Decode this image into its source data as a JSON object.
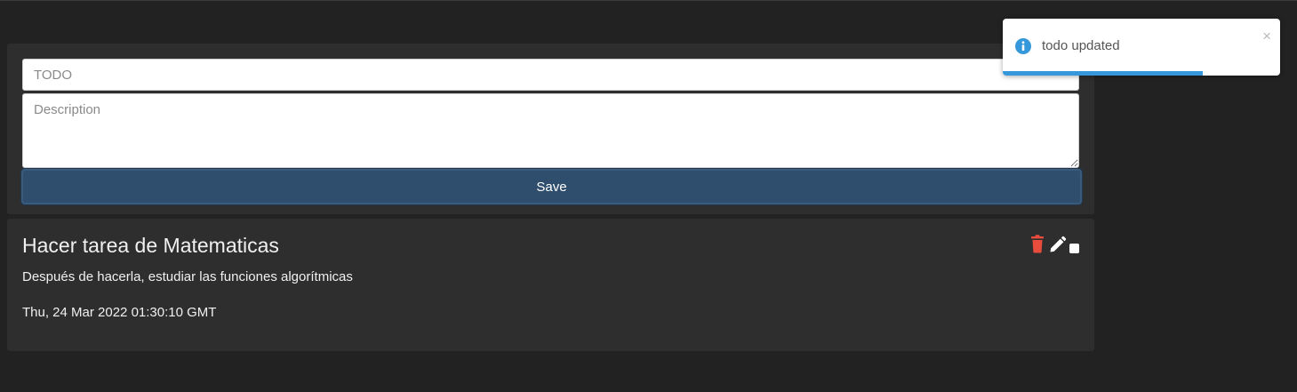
{
  "form": {
    "todo_placeholder": "TODO",
    "todo_value": "",
    "description_placeholder": "Description",
    "description_value": "",
    "save_label": "Save"
  },
  "todos": [
    {
      "title": "Hacer tarea de Matematicas",
      "description": "Después de hacerla, estudiar las funciones algorítmicas",
      "date": "Thu, 24 Mar 2022 01:30:10 GMT",
      "completed": false
    }
  ],
  "icons": {
    "delete": "trash-icon",
    "edit": "pencil-icon",
    "toast": "info-icon",
    "close": "close-icon"
  },
  "toast": {
    "message": "todo updated",
    "close_symbol": "×",
    "progress": 0.72
  },
  "colors": {
    "background": "#222222",
    "card": "#2e2e2e",
    "save_button": "#2f4e6e",
    "delete_icon": "#e74c3c",
    "toast_accent": "#3498db"
  }
}
